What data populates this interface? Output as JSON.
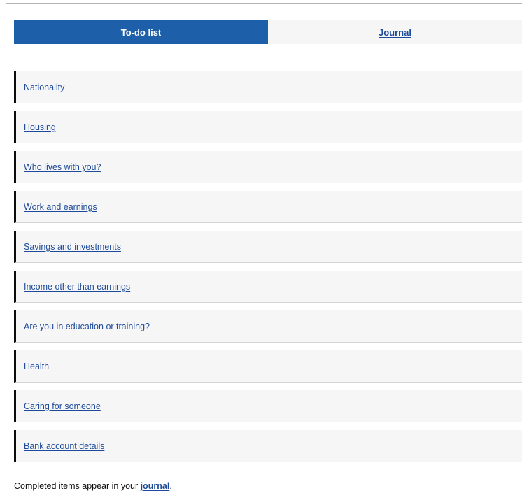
{
  "tabs": {
    "todo_label": "To-do list",
    "journal_label": "Journal"
  },
  "tasks": [
    {
      "label": "Nationality"
    },
    {
      "label": "Housing"
    },
    {
      "label": "Who lives with you?"
    },
    {
      "label": "Work and earnings"
    },
    {
      "label": "Savings and investments"
    },
    {
      "label": "Income other than earnings"
    },
    {
      "label": "Are you in education or training?"
    },
    {
      "label": "Health"
    },
    {
      "label": "Caring for someone"
    },
    {
      "label": "Bank account details"
    }
  ],
  "footer": {
    "text_before": "Completed items appear in your ",
    "link_text": "journal",
    "text_after": "."
  },
  "colors": {
    "active_tab": "#1d5fa8",
    "link": "#1d4a9a",
    "item_background": "#f6f6f6",
    "item_border": "#0b0c0c"
  }
}
